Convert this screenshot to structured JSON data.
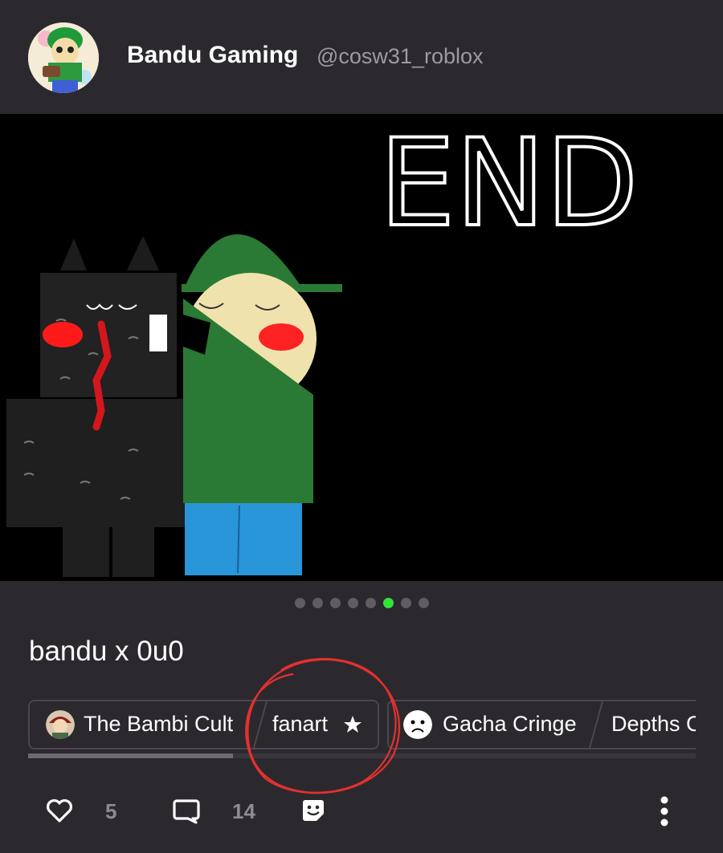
{
  "author": {
    "name": "Bandu Gaming",
    "handle": "@cosw31_roblox",
    "avatar_icon": "avatar-icon"
  },
  "post": {
    "image_text": "END",
    "carousel": {
      "total": 8,
      "active_index": 5
    },
    "title": "bandu x 0u0"
  },
  "chips": [
    {
      "icon": "community-avatar-icon",
      "label": "The Bambi Cult"
    },
    {
      "icon": "star-icon",
      "label": "fanart"
    },
    {
      "icon": "sad-face-icon",
      "label": "Gacha Cringe"
    },
    {
      "icon": "",
      "label": "Depths C"
    }
  ],
  "actions": {
    "likes": "5",
    "comments": "14"
  },
  "colors": {
    "background": "#2b292e",
    "accent": "#2fe53a",
    "annotation": "#e53030"
  }
}
